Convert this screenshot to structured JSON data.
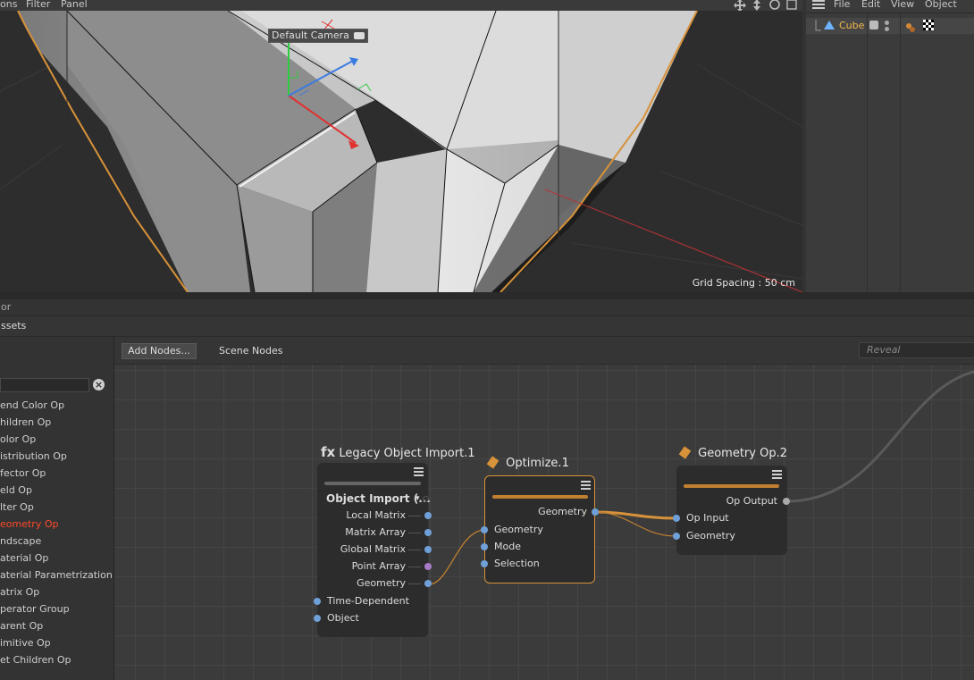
{
  "viewport": {
    "menu": [
      "ons",
      "Filter",
      "Panel"
    ],
    "camera_label": "Default Camera",
    "grid_spacing": "Grid Spacing : 50 cm"
  },
  "object_manager": {
    "menu": [
      "File",
      "Edit",
      "View",
      "Object"
    ],
    "object_name": "Cube"
  },
  "node_editor": {
    "title": "or",
    "assets_tab": "ssets",
    "add_nodes": "Add Nodes...",
    "scene_nodes": "Scene Nodes",
    "reveal_placeholder": "Reveal",
    "sidebar_items": [
      {
        "label": "end Color Op",
        "active": false
      },
      {
        "label": "hildren Op",
        "active": false
      },
      {
        "label": "olor Op",
        "active": false
      },
      {
        "label": "istribution Op",
        "active": false
      },
      {
        "label": "fector Op",
        "active": false
      },
      {
        "label": "eld Op",
        "active": false
      },
      {
        "label": "lter Op",
        "active": false
      },
      {
        "label": "eometry Op",
        "active": true
      },
      {
        "label": "ndscape",
        "active": false
      },
      {
        "label": "aterial Op",
        "active": false
      },
      {
        "label": "aterial Parametrization",
        "active": false
      },
      {
        "label": "atrix Op",
        "active": false
      },
      {
        "label": "perator Group",
        "active": false
      },
      {
        "label": "arent Op",
        "active": false
      },
      {
        "label": "imitive Op",
        "active": false
      },
      {
        "label": "et Children Op",
        "active": false
      }
    ],
    "nodes": {
      "legacy": {
        "fx": "fx",
        "title": "Legacy Object Import.1",
        "header": "Object Import (...",
        "outputs": [
          "Local Matrix",
          "Matrix Array",
          "Global Matrix",
          "Point Array",
          "Geometry"
        ],
        "inputs": [
          "Time-Dependent",
          "Object"
        ]
      },
      "optimize": {
        "title": "Optimize.1",
        "outputs": [
          "Geometry"
        ],
        "inputs": [
          "Geometry",
          "Mode",
          "Selection"
        ]
      },
      "geomop": {
        "title": "Geometry Op.2",
        "outputs": [
          "Op Output"
        ],
        "inputs": [
          "Op Input",
          "Geometry"
        ]
      }
    },
    "colors": {
      "accent_orange": "#d7923a",
      "port_blue": "#6fa0d8",
      "port_purple": "#a77bc9",
      "active_item": "#ff4a2a"
    }
  }
}
